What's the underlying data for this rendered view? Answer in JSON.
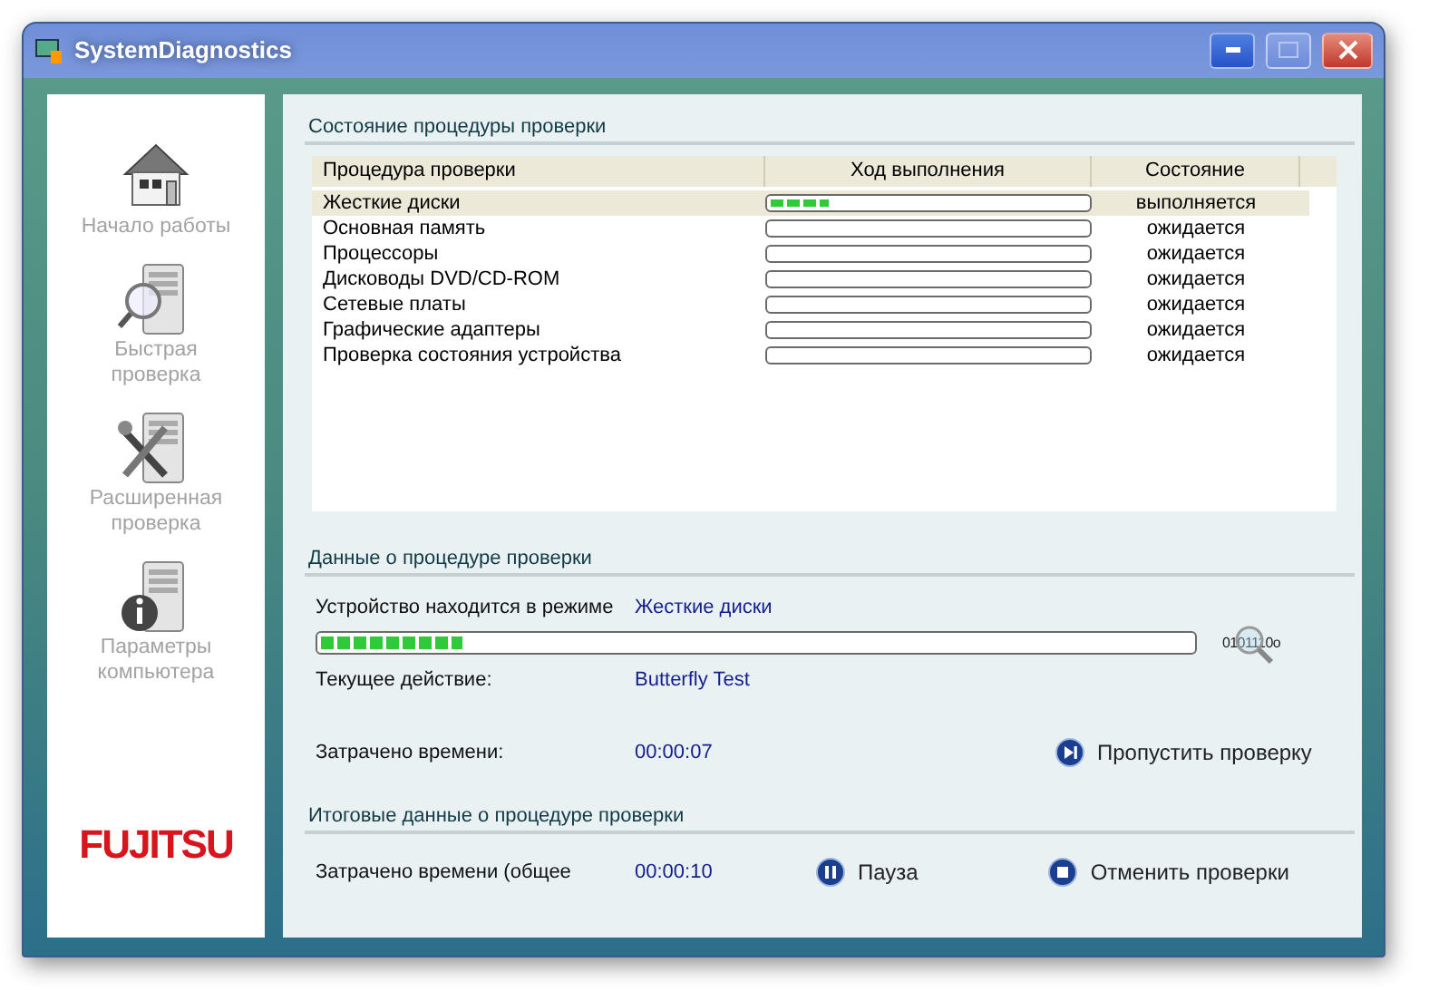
{
  "window": {
    "title": "SystemDiagnostics"
  },
  "sidebar": {
    "items": [
      {
        "kind": "home",
        "label": "Начало работы"
      },
      {
        "kind": "quick",
        "label": "Быстрая проверка"
      },
      {
        "kind": "advanced",
        "label": "Расширенная проверка"
      },
      {
        "kind": "info",
        "label": "Параметры компьютера"
      }
    ],
    "logo": "FUJITSU"
  },
  "status_section": {
    "title": "Состояние процедуры проверки",
    "table": {
      "columns": [
        "Процедура проверки",
        "Ход выполнения",
        "Состояние"
      ],
      "rows": [
        {
          "name": "Жесткие диски",
          "level": 0.2,
          "status": "выполняется",
          "selected": true
        },
        {
          "name": "Основная память",
          "status": "ожидается",
          "selected": false
        },
        {
          "name": "Процессоры",
          "status": "ожидается",
          "selected": false
        },
        {
          "name": "Дисководы DVD/CD-ROM",
          "status": "ожидается",
          "selected": false
        },
        {
          "name": "Сетевые платы",
          "status": "ожидается",
          "selected": false
        },
        {
          "name": "Графические адаптеры",
          "status": "ожидается",
          "selected": false
        },
        {
          "name": "Проверка состояния устройства",
          "status": "ожидается",
          "selected": false
        }
      ]
    }
  },
  "details_section": {
    "title": "Данные о процедуре проверки",
    "mode_label": "Устройство находится в режиме",
    "mode_value": "Жесткие диски",
    "progress": {
      "level": 0.17
    },
    "scan_indicator": "0101110o",
    "action_label": "Текущее действие:",
    "action_value": "Butterfly Test",
    "time_label": "Затрачено времени:",
    "time_value": "00:00:07",
    "skip_button": "Пропустить проверку"
  },
  "summary_section": {
    "title": "Итоговые данные о процедуре проверки",
    "time_label": "Затрачено времени (общее",
    "time_value": "00:00:10",
    "pause_button": "Пауза",
    "cancel_button": "Отменить проверки"
  }
}
